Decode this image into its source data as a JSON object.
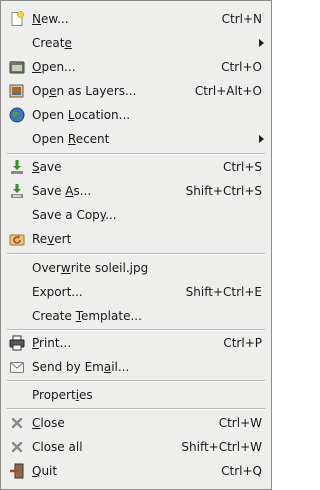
{
  "menu": {
    "items": [
      {
        "id": "new",
        "icon": "new-document-icon",
        "pre": "",
        "ul": "N",
        "post": "ew...",
        "accel": "Ctrl+N",
        "submenu": false
      },
      {
        "id": "create",
        "icon": "",
        "pre": "Creat",
        "ul": "e",
        "post": "",
        "accel": "",
        "submenu": true
      },
      {
        "id": "open",
        "icon": "open-folder-icon",
        "pre": "",
        "ul": "O",
        "post": "pen...",
        "accel": "Ctrl+O",
        "submenu": false
      },
      {
        "id": "open-as-layers",
        "icon": "open-as-layers-icon",
        "pre": "Op",
        "ul": "e",
        "post": "n as Layers...",
        "accel": "Ctrl+Alt+O",
        "submenu": false
      },
      {
        "id": "open-location",
        "icon": "globe-icon",
        "pre": "Open ",
        "ul": "L",
        "post": "ocation...",
        "accel": "",
        "submenu": false
      },
      {
        "id": "open-recent",
        "icon": "",
        "pre": "Open ",
        "ul": "R",
        "post": "ecent",
        "accel": "",
        "submenu": true
      },
      {
        "id": "save",
        "icon": "save-icon",
        "pre": "",
        "ul": "S",
        "post": "ave",
        "accel": "Ctrl+S",
        "submenu": false
      },
      {
        "id": "save-as",
        "icon": "save-as-icon",
        "pre": "Save ",
        "ul": "A",
        "post": "s...",
        "accel": "Shift+Ctrl+S",
        "submenu": false
      },
      {
        "id": "save-copy",
        "icon": "",
        "pre": "Save a Cop",
        "ul": "y",
        "post": "...",
        "accel": "",
        "submenu": false
      },
      {
        "id": "revert",
        "icon": "revert-icon",
        "pre": "Re",
        "ul": "v",
        "post": "ert",
        "accel": "",
        "submenu": false
      },
      {
        "id": "overwrite",
        "icon": "",
        "pre": "Over",
        "ul": "w",
        "post": "rite soleil.jpg",
        "accel": "",
        "submenu": false
      },
      {
        "id": "export",
        "icon": "",
        "pre": "Export...",
        "ul": "",
        "post": "",
        "accel": "Shift+Ctrl+E",
        "submenu": false
      },
      {
        "id": "create-template",
        "icon": "",
        "pre": "Create ",
        "ul": "T",
        "post": "emplate...",
        "accel": "",
        "submenu": false
      },
      {
        "id": "print",
        "icon": "printer-icon",
        "pre": "",
        "ul": "P",
        "post": "rint...",
        "accel": "Ctrl+P",
        "submenu": false
      },
      {
        "id": "send-email",
        "icon": "envelope-icon",
        "pre": "Send by Em",
        "ul": "a",
        "post": "il...",
        "accel": "",
        "submenu": false
      },
      {
        "id": "properties",
        "icon": "",
        "pre": "Propert",
        "ul": "i",
        "post": "es",
        "accel": "",
        "submenu": false
      },
      {
        "id": "close",
        "icon": "close-x-icon",
        "pre": "",
        "ul": "C",
        "post": "lose",
        "accel": "Ctrl+W",
        "submenu": false
      },
      {
        "id": "close-all",
        "icon": "close-x-icon",
        "pre": "Close all",
        "ul": "",
        "post": "",
        "accel": "Shift+Ctrl+W",
        "submenu": false
      },
      {
        "id": "quit",
        "icon": "quit-icon",
        "pre": "",
        "ul": "Q",
        "post": "uit",
        "accel": "Ctrl+Q",
        "submenu": false
      }
    ]
  }
}
